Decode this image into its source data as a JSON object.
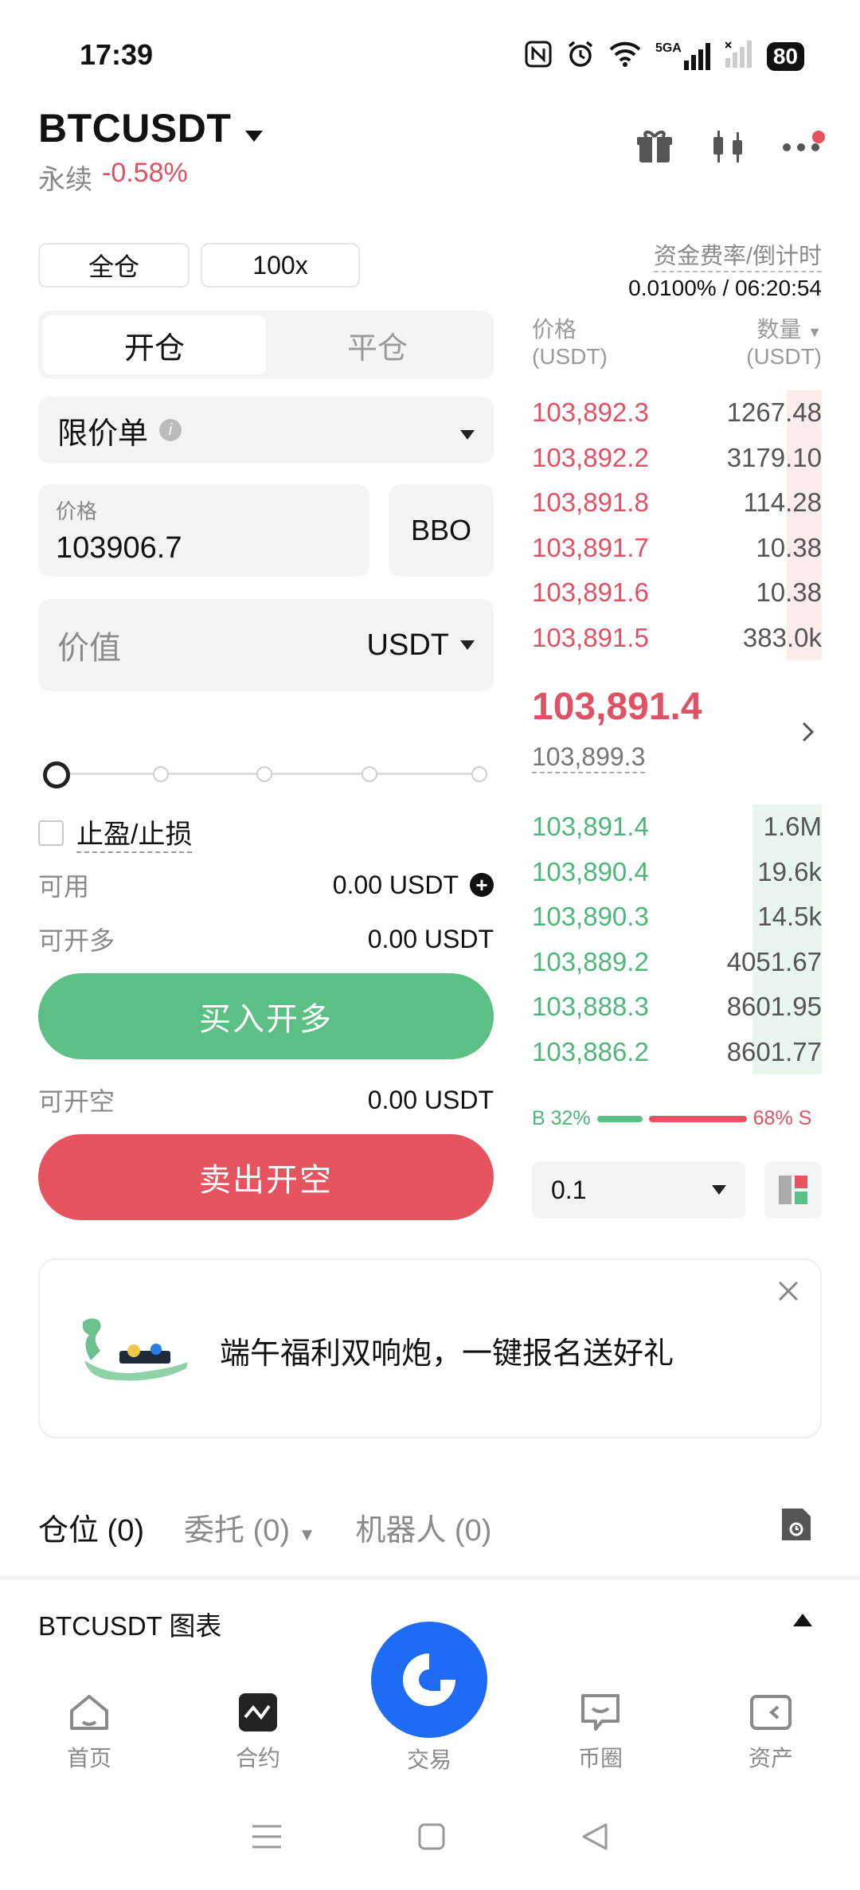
{
  "status": {
    "time": "17:39",
    "network": "5GA",
    "battery": "80"
  },
  "header": {
    "pair": "BTCUSDT",
    "type": "永续",
    "change": "-0.58%"
  },
  "margin": {
    "mode": "全仓",
    "leverage": "100x"
  },
  "trade_tabs": {
    "open": "开仓",
    "close": "平仓"
  },
  "order_type": "限价单",
  "price": {
    "label": "价格",
    "value": "103906.7",
    "bbo": "BBO"
  },
  "value": {
    "placeholder": "价值",
    "unit": "USDT"
  },
  "tpsl": "止盈/止损",
  "available": {
    "label": "可用",
    "value": "0.00 USDT"
  },
  "can_long": {
    "label": "可开多",
    "value": "0.00 USDT"
  },
  "can_short": {
    "label": "可开空",
    "value": "0.00 USDT"
  },
  "buttons": {
    "buy": "买入开多",
    "sell": "卖出开空"
  },
  "orderbook": {
    "funding_label": "资金费率/倒计时",
    "funding_value": "0.0100% / 06:20:54",
    "col_price": "价格",
    "col_price_unit": "(USDT)",
    "col_qty": "数量",
    "col_qty_unit": "(USDT)",
    "asks": [
      {
        "price": "103,892.3",
        "qty": "1267.48",
        "depth": 0.12
      },
      {
        "price": "103,892.2",
        "qty": "3179.10",
        "depth": 0.12
      },
      {
        "price": "103,891.8",
        "qty": "114.28",
        "depth": 0.12
      },
      {
        "price": "103,891.7",
        "qty": "10.38",
        "depth": 0.12
      },
      {
        "price": "103,891.6",
        "qty": "10.38",
        "depth": 0.12
      },
      {
        "price": "103,891.5",
        "qty": "383.0k",
        "depth": 0.12
      }
    ],
    "last_price": "103,891.4",
    "mark_price": "103,899.3",
    "bids": [
      {
        "price": "103,891.4",
        "qty": "1.6M",
        "depth": 0.24
      },
      {
        "price": "103,890.4",
        "qty": "19.6k",
        "depth": 0.24
      },
      {
        "price": "103,890.3",
        "qty": "14.5k",
        "depth": 0.24
      },
      {
        "price": "103,889.2",
        "qty": "4051.67",
        "depth": 0.24
      },
      {
        "price": "103,888.3",
        "qty": "8601.95",
        "depth": 0.24
      },
      {
        "price": "103,886.2",
        "qty": "8601.77",
        "depth": 0.24
      }
    ],
    "buy_ratio": "B 32%",
    "sell_ratio": "68% S",
    "buy_pct": 32,
    "depth_step": "0.1"
  },
  "banner": {
    "text": "端午福利双响炮，一键报名送好礼"
  },
  "position_tabs": {
    "positions": "仓位 (0)",
    "orders": "委托 (0)",
    "bots": "机器人 (0)"
  },
  "chart_toggle": "BTCUSDT 图表",
  "nav": {
    "home": "首页",
    "contract": "合约",
    "trade": "交易",
    "community": "币圈",
    "assets": "资产"
  },
  "colors": {
    "up": "#5cbf84",
    "down": "#e5545f",
    "accent": "#1e6bf5"
  }
}
